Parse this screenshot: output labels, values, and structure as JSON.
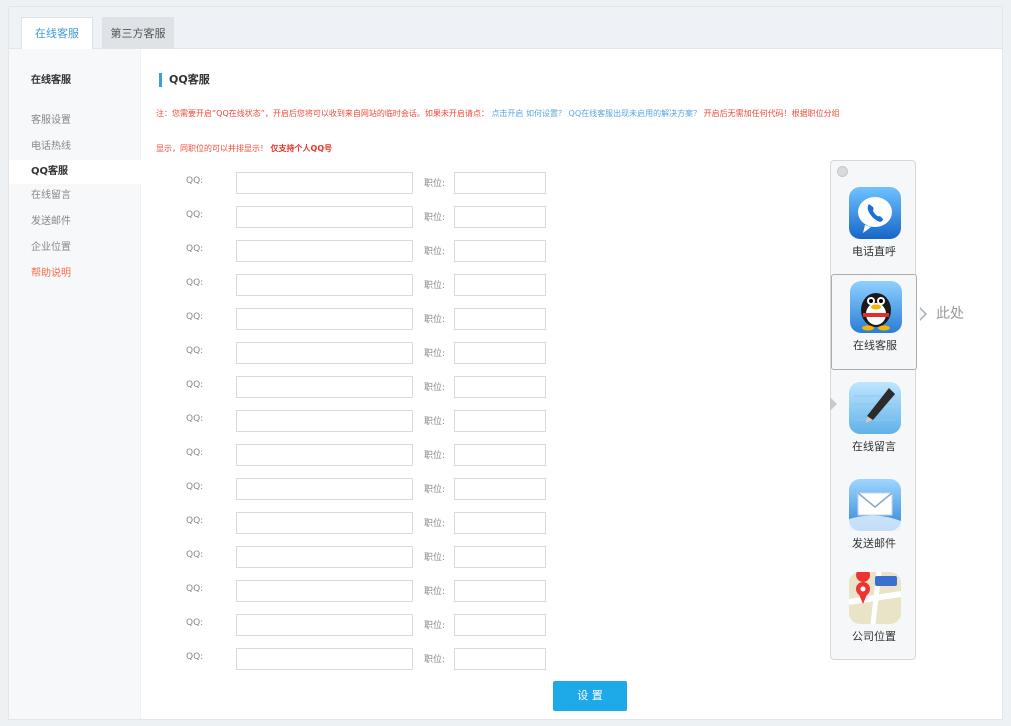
{
  "tabs": [
    {
      "label": "在线客服",
      "active": true
    },
    {
      "label": "第三方客服",
      "active": false
    }
  ],
  "sidebar": {
    "header": "在线客服",
    "items": [
      {
        "label": "客服设置"
      },
      {
        "label": "电话热线"
      },
      {
        "label": "QQ客服",
        "active": true
      },
      {
        "label": "在线留言"
      },
      {
        "label": "发送邮件"
      },
      {
        "label": "企业位置"
      },
      {
        "label": "帮助说明",
        "highlight": true
      }
    ]
  },
  "main": {
    "title": "QQ客服",
    "note_part1": "注：您需要开启“QQ在线状态”，开启后您将可以收到来自网站的临时会话。如果未开启请点：",
    "note_link1": "点击开启 如何设置？",
    "note_link2": "QQ在线客服出现未启用的解决方案？",
    "note_part2": "开启后无需加任何代码！根据职位分组",
    "note_line2": "显示，同职位的可以并排显示！",
    "note_bold": "仅支持个人QQ号",
    "qq_label": "QQ:",
    "position_label": "职位:",
    "row_count": 15,
    "submit_label": "设 置"
  },
  "widget": {
    "items": [
      {
        "label": "电话直呼",
        "icon": "phone-icon"
      },
      {
        "label": "在线客服",
        "icon": "qq-penguin-icon",
        "highlight": true
      },
      {
        "label": "在线留言",
        "icon": "pen-icon"
      },
      {
        "label": "发送邮件",
        "icon": "mail-icon"
      },
      {
        "label": "公司位置",
        "icon": "map-icon"
      }
    ],
    "pointer_label": "此处"
  },
  "colors": {
    "accent": "#3a9ee4",
    "button": "#1ea9e8",
    "warning": "#f04a3a",
    "link": "#5aa6e0"
  }
}
